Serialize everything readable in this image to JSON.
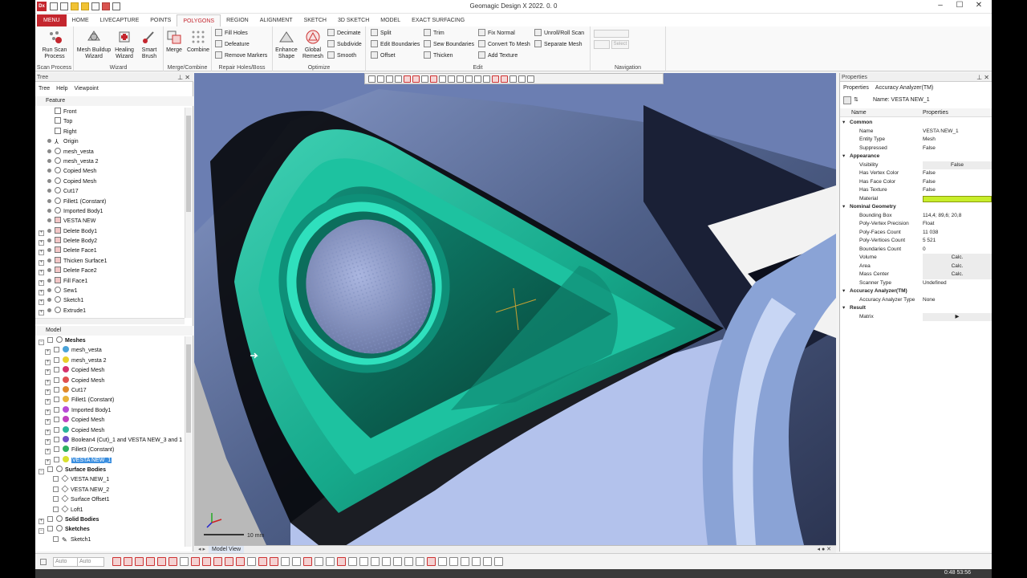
{
  "window": {
    "title": "Geomagic Design X 2022. 0. 0",
    "app_icon": "Dx"
  },
  "tabs": [
    {
      "label": "MENU"
    },
    {
      "label": "HOME"
    },
    {
      "label": "LIVECAPTURE"
    },
    {
      "label": "POINTS"
    },
    {
      "label": "POLYGONS"
    },
    {
      "label": "REGION"
    },
    {
      "label": "ALIGNMENT"
    },
    {
      "label": "SKETCH"
    },
    {
      "label": "3D SKETCH"
    },
    {
      "label": "MODEL"
    },
    {
      "label": "EXACT SURFACING"
    }
  ],
  "ribbon": {
    "groups": {
      "scan": "Scan Process",
      "wizard": "Wizard",
      "merge": "Merge/Combine",
      "repair": "Repair Holes/Boss",
      "optimize": "Optimize",
      "edit": "Edit",
      "navigation": "Navigation"
    },
    "run_scan": "Run Scan Process",
    "mesh_buildup": "Mesh Buildup Wizard",
    "healing": "Healing Wizard",
    "smart_brush": "Smart Brush",
    "merge": "Merge",
    "combine": "Combine",
    "fill_holes": "Fill Holes",
    "defeature": "Defeature",
    "remove_markers": "Remove Markers",
    "enhance_shape": "Enhance Shape",
    "global_remesh": "Global Remesh",
    "decimate": "Decimate",
    "subdivide": "Subdivide",
    "smooth": "Smooth",
    "split": "Split",
    "edit_boundaries": "Edit Boundaries",
    "offset": "Offset",
    "trim": "Trim",
    "sew_boundaries": "Sew Boundaries",
    "thicken": "Thicken",
    "fix_normal": "Fix Normal",
    "convert_to_mesh": "Convert To Mesh",
    "add_texture": "Add Texture",
    "unroll": "Unroll/Roll Scan",
    "separate_mesh": "Separate Mesh",
    "nav_select": "Select"
  },
  "tree_panel": {
    "title": "Tree",
    "subtabs": [
      "Tree",
      "Help",
      "Viewpoint"
    ],
    "feature_header": "Feature",
    "features": [
      "Front",
      "Top",
      "Right",
      "Origin",
      "mesh_vesta",
      "mesh_vesta 2",
      "Copied Mesh",
      "Copied Mesh",
      "Cut17",
      "Fillet1 (Constant)",
      "Imported Body1",
      "VESTA NEW",
      "Delete Body1",
      "Delete Body2",
      "Delete Face1",
      "Thicken Surface1",
      "Delete Face2",
      "Fill Face1",
      "Sew1",
      "Sketch1",
      "Extrude1"
    ],
    "model_header": "Model",
    "meshes_header": "Meshes",
    "meshes": [
      {
        "label": "mesh_vesta",
        "color": "#4aa3d8"
      },
      {
        "label": "mesh_vesta 2",
        "color": "#e8d02a"
      },
      {
        "label": "Copied Mesh",
        "color": "#d6336c"
      },
      {
        "label": "Copied Mesh",
        "color": "#e05050"
      },
      {
        "label": "Cut17",
        "color": "#e08a2a"
      },
      {
        "label": "Fillet1 (Constant)",
        "color": "#e8b23a"
      },
      {
        "label": "Imported Body1",
        "color": "#b84ad6"
      },
      {
        "label": "Copied Mesh",
        "color": "#c040c0"
      },
      {
        "label": "Copied Mesh",
        "color": "#2ab59a"
      },
      {
        "label": "Boolean4 (Cut)_1 and VESTA NEW_3 and 1",
        "color": "#7050c8"
      },
      {
        "label": "Fillet3 (Constant)",
        "color": "#30b060"
      },
      {
        "label": "VESTA NEW_1",
        "color": "#d8e030"
      }
    ],
    "surface_header": "Surface Bodies",
    "surfaces": [
      "VESTA NEW_1",
      "VESTA NEW_2",
      "Surface Offset1",
      "Loft1"
    ],
    "solid_header": "Solid Bodies",
    "sketches_header": "Sketches",
    "sketches": [
      "Sketch1"
    ]
  },
  "viewport": {
    "tab_label": "Model View",
    "scale_label": "10 mm"
  },
  "properties_panel": {
    "title": "Properties",
    "subtabs": [
      "Properties",
      "Accuracy Analyzer(TM)"
    ],
    "name_field": "Name: VESTA NEW_1",
    "col_name": "Name",
    "col_props": "Properties",
    "rows": [
      {
        "type": "cat",
        "name": "Common",
        "value": ""
      },
      {
        "type": "row",
        "name": "Name",
        "value": "VESTA NEW_1"
      },
      {
        "type": "row",
        "name": "Entity Type",
        "value": "Mesh"
      },
      {
        "type": "row",
        "name": "Suppressed",
        "value": "False"
      },
      {
        "type": "cat",
        "name": "Appearance",
        "value": ""
      },
      {
        "type": "btn",
        "name": "Visibility",
        "value": "False"
      },
      {
        "type": "row",
        "name": "Has Vertex Color",
        "value": "False"
      },
      {
        "type": "row",
        "name": "Has Face Color",
        "value": "False"
      },
      {
        "type": "row",
        "name": "Has Texture",
        "value": "False"
      },
      {
        "type": "color",
        "name": "Material",
        "value": "#c8ee2a"
      },
      {
        "type": "cat",
        "name": "Nominal Geometry",
        "value": ""
      },
      {
        "type": "row",
        "name": "Bounding Box",
        "value": "114,4; 89,6; 20,8"
      },
      {
        "type": "row",
        "name": "Poly-Vertex Precision",
        "value": "Float"
      },
      {
        "type": "row",
        "name": "Poly-Faces Count",
        "value": "11 038"
      },
      {
        "type": "row",
        "name": "Poly-Vertices Count",
        "value": "5 521"
      },
      {
        "type": "row",
        "name": "Boundaries Count",
        "value": "0"
      },
      {
        "type": "btn",
        "name": "Volume",
        "value": "Calc."
      },
      {
        "type": "btn",
        "name": "Area",
        "value": "Calc."
      },
      {
        "type": "btn",
        "name": "Mass Center",
        "value": "Calc."
      },
      {
        "type": "row",
        "name": "Scanner Type",
        "value": "Undefined"
      },
      {
        "type": "cat",
        "name": "Accuracy Analyzer(TM)",
        "value": ""
      },
      {
        "type": "row",
        "name": "Accuracy Analyzer Type",
        "value": "None"
      },
      {
        "type": "cat",
        "name": "Result",
        "value": ""
      },
      {
        "type": "btn",
        "name": "Matrix",
        "value": "▶"
      }
    ]
  },
  "statusbar": {
    "field1": "Auto",
    "field2": "Auto"
  },
  "clock": "0:48 53:56"
}
